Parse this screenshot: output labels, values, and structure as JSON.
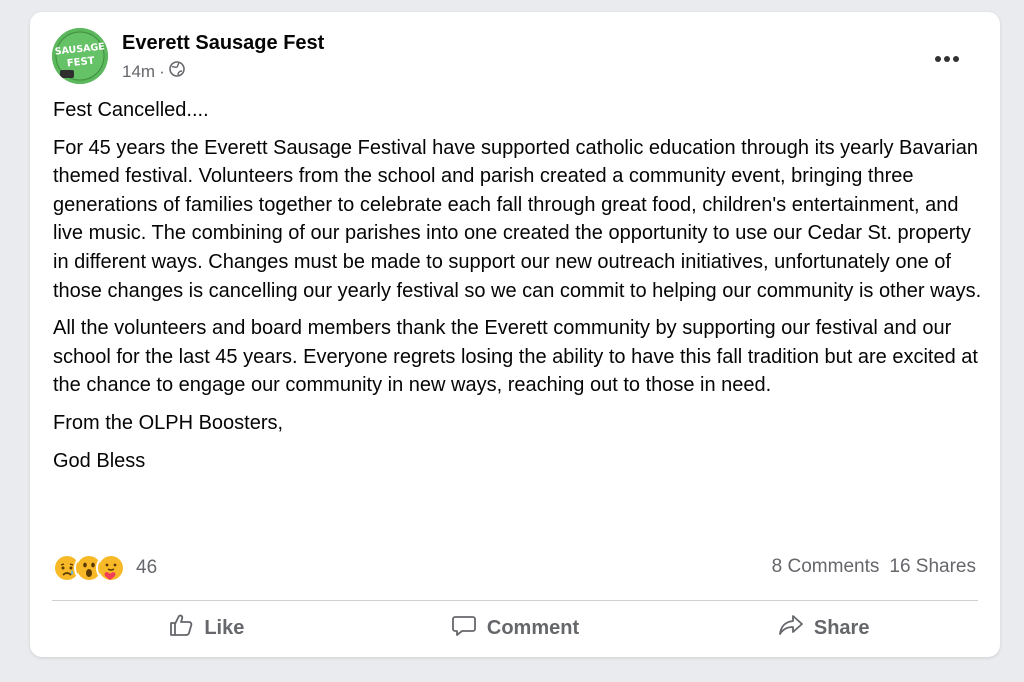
{
  "post": {
    "author": "Everett Sausage Fest",
    "avatar_text_top": "SAUSAGE",
    "avatar_text_bottom": "FEST",
    "time": "14m",
    "visibility_icon": "globe-icon",
    "more_icon": "ellipsis-icon",
    "paragraphs": [
      "Fest Cancelled....",
      "For 45 years the Everett Sausage Festival have supported catholic education through its yearly Bavarian themed festival. Volunteers from the school and parish created a community event, bringing three generations of families together to celebrate each fall through great food, children's entertainment, and live music. The combining of our parishes into one created the opportunity to use our Cedar St. property in different ways. Changes must be made to support our new outreach initiatives, unfortunately one of those changes is cancelling our yearly festival so we can commit to helping our community is other ways.",
      "All the volunteers and board members thank the Everett community by supporting our festival and our school for the last 45 years. Everyone regrets losing the ability to have this fall tradition but are excited at the chance to engage our community in new ways, reaching out to those in need.",
      "From the OLPH Boosters,",
      "God Bless"
    ]
  },
  "reactions": {
    "icons": [
      "sad-reaction-icon",
      "wow-reaction-icon",
      "care-reaction-icon"
    ],
    "count": "46"
  },
  "stats": {
    "comments": "8 Comments",
    "shares": "16 Shares"
  },
  "actions": {
    "like_label": "Like",
    "comment_label": "Comment",
    "share_label": "Share"
  },
  "colors": {
    "page_background": "#e9ebee",
    "card_background": "#ffffff",
    "secondary_text": "#65676b",
    "avatar_green": "#4caf50"
  }
}
